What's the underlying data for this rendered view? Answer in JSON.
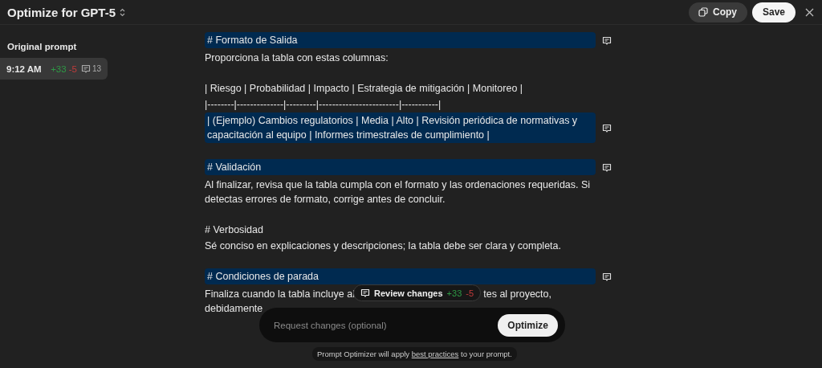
{
  "header": {
    "title": "Optimize for GPT-5",
    "copy": "Copy",
    "save": "Save"
  },
  "sidebar": {
    "heading": "Original prompt",
    "versions": [
      {
        "time": "9:12 AM",
        "added": "+33",
        "removed": "-5",
        "comments": "13",
        "selected": true
      }
    ]
  },
  "sections": [
    {
      "blocks": [
        {
          "text": "# Formato de Salida",
          "highlighted": true
        },
        {
          "text": "Proporciona la tabla con estas columnas:",
          "highlighted": false
        }
      ]
    },
    {
      "blocks": [
        {
          "text": "| Riesgo | Probabilidad | Impacto | Estrategia de mitigación | Monitoreo |",
          "highlighted": false
        },
        {
          "text": "|--------|--------------|---------|------------------------|-----------|",
          "highlighted": false
        },
        {
          "text": "| (Ejemplo) Cambios regulatorios | Media | Alto | Revisión periódica de normativas y capacitación al equipo | Informes trimestrales de cumplimiento |",
          "highlighted": true
        }
      ]
    },
    {
      "blocks": [
        {
          "text": "# Validación",
          "highlighted": true
        },
        {
          "text": "Al finalizar, revisa que la tabla cumpla con el formato y las ordenaciones requeridas. Si detectas errores de formato, corrige antes de concluir.",
          "highlighted": false
        }
      ]
    },
    {
      "blocks": [
        {
          "text": "# Verbosidad",
          "highlighted": false
        },
        {
          "text": "Sé conciso en explicaciones y descripciones; la tabla debe ser clara y completa.",
          "highlighted": false
        }
      ]
    },
    {
      "blocks": [
        {
          "text": "# Condiciones de parada",
          "highlighted": true
        }
      ],
      "covered_text": {
        "line_1_start": "Finaliza cuando la tabla incluye al",
        "line_1_end": "tes al proyecto,",
        "line_2": "debidamente"
      }
    }
  ],
  "review": {
    "label": "Review changes",
    "added": "+33",
    "removed": "-5"
  },
  "request": {
    "placeholder": "Request changes (optional)",
    "button": "Optimize"
  },
  "footer": {
    "before": "Prompt Optimizer will apply ",
    "link": "best practices",
    "after": " to your prompt."
  }
}
